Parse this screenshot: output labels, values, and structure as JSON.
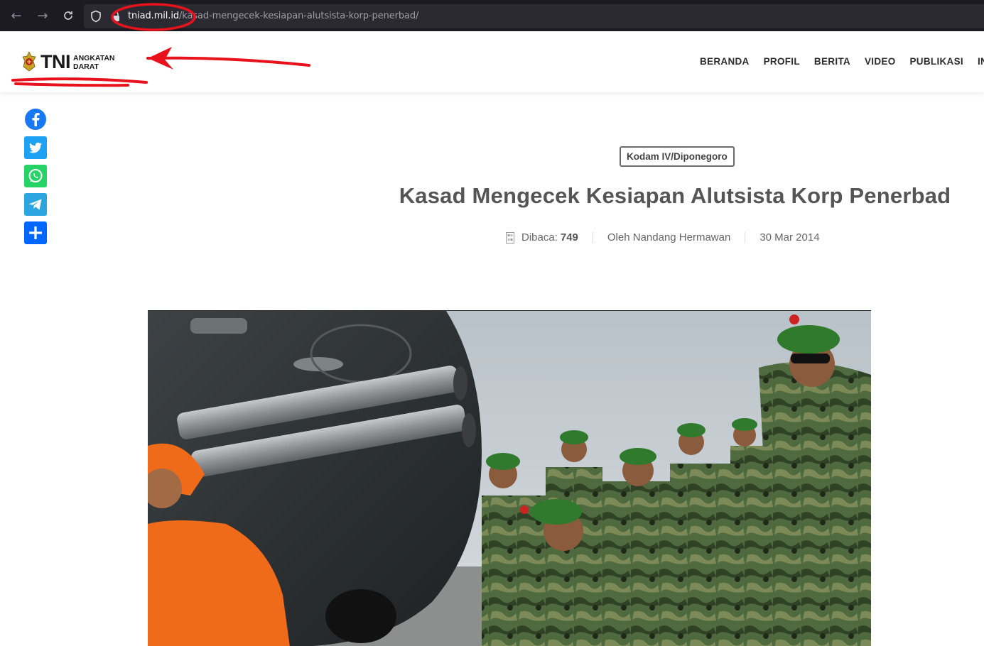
{
  "browser": {
    "url_domain": "tniad.mil.id",
    "url_path": "/kasad-mengecek-kesiapan-alutsista-korp-penerbad/"
  },
  "site": {
    "logo_main": "TNI",
    "logo_line1": "ANGKATAN",
    "logo_line2": "DARAT",
    "nav": [
      "BERANDA",
      "PROFIL",
      "BERITA",
      "VIDEO",
      "PUBLIKASI",
      "INFOR"
    ]
  },
  "share": [
    "facebook-icon",
    "twitter-icon",
    "whatsapp-icon",
    "telegram-icon",
    "share-plus-icon"
  ],
  "article": {
    "category": "Kodam IV/Diponegoro",
    "title": "Kasad Mengecek Kesiapan Alutsista Korp Penerbad",
    "views_label": "Dibaca:",
    "views_value": "749",
    "author": "Oleh Nandang Hermawan",
    "date": "30 Mar 2014"
  },
  "colors": {
    "browser_bg": "#1c1b22",
    "urlbar_bg": "#2b2a33",
    "annotation_red": "#e8121c",
    "facebook": "#1877f2",
    "twitter": "#1da1f2",
    "whatsapp": "#25d366",
    "telegram": "#2ca5e0",
    "share": "#0166ff"
  }
}
